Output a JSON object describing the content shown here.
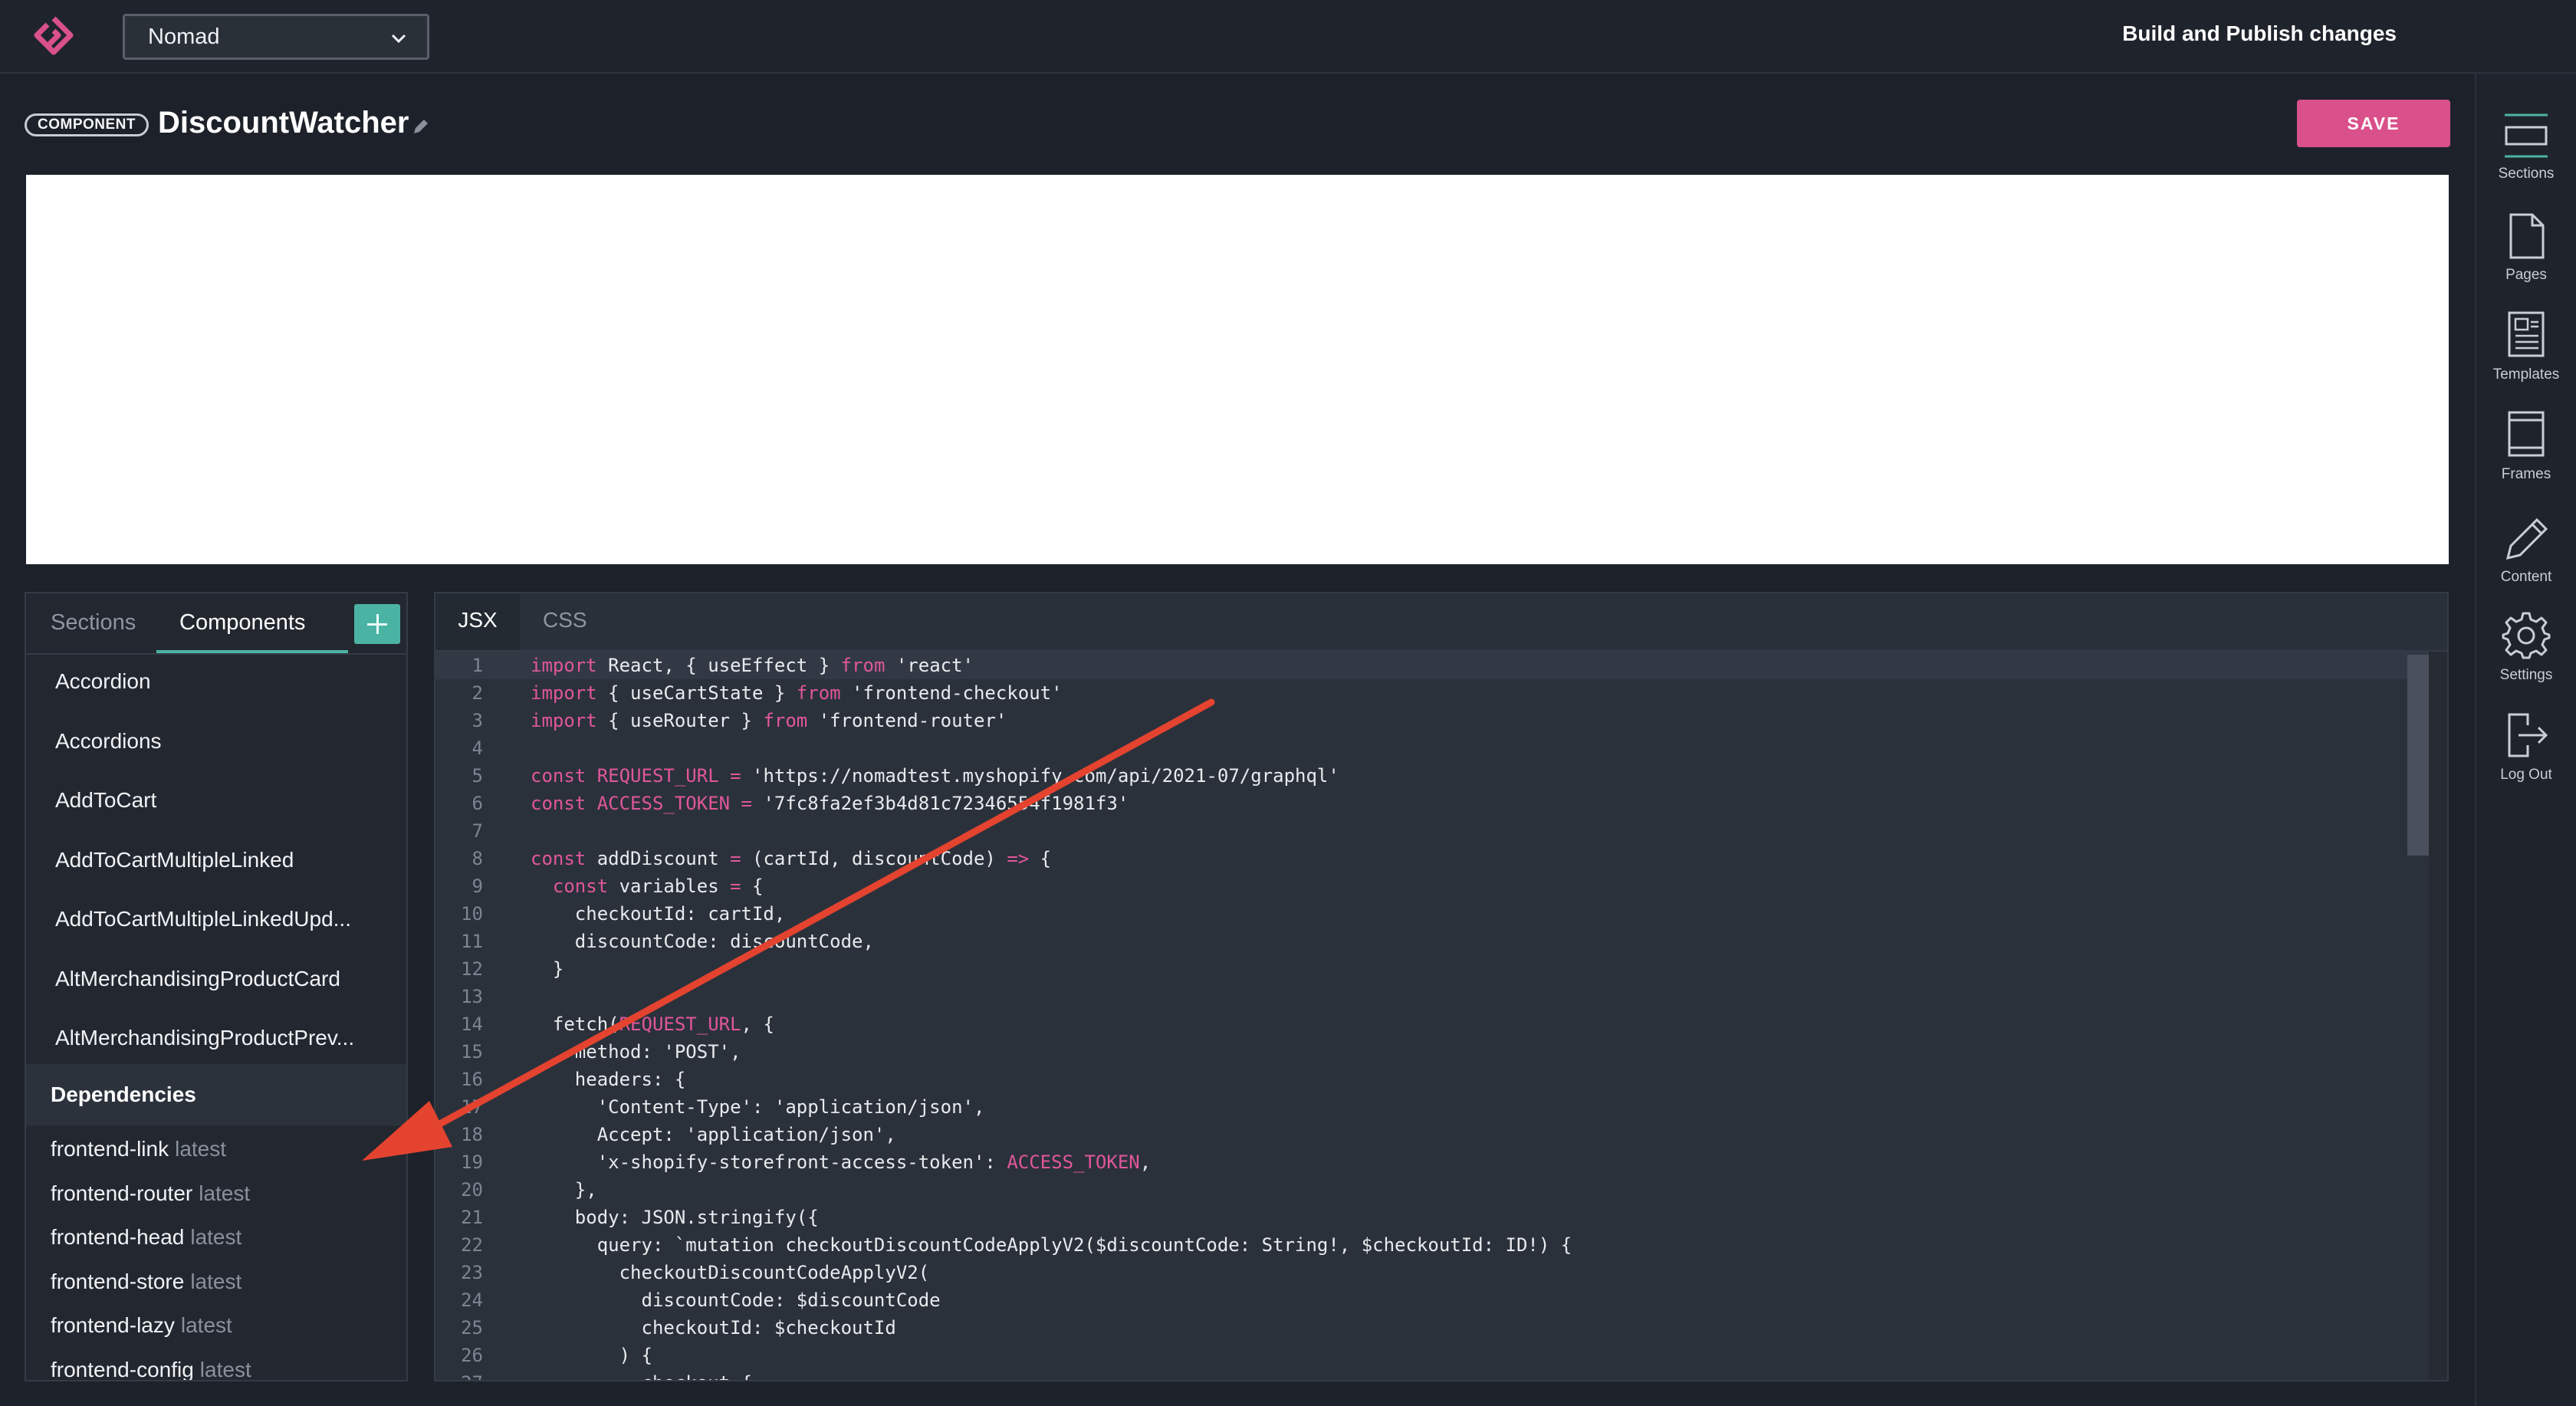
{
  "topbar": {
    "project": "Nomad",
    "publish_label": "Build and Publish changes"
  },
  "header": {
    "badge": "COMPONENT",
    "title": "DiscountWatcher",
    "save_label": "SAVE"
  },
  "left_panel": {
    "tabs": [
      "Sections",
      "Components"
    ],
    "active_tab": "Components",
    "components": [
      "Accordion",
      "Accordions",
      "AddToCart",
      "AddToCartMultipleLinked",
      "AddToCartMultipleLinkedUpd...",
      "AltMerchandisingProductCard",
      "AltMerchandisingProductPrev..."
    ],
    "dependencies_title": "Dependencies",
    "dependencies": [
      {
        "name": "frontend-link",
        "version": "latest"
      },
      {
        "name": "frontend-router",
        "version": "latest"
      },
      {
        "name": "frontend-head",
        "version": "latest"
      },
      {
        "name": "frontend-store",
        "version": "latest"
      },
      {
        "name": "frontend-lazy",
        "version": "latest"
      },
      {
        "name": "frontend-config",
        "version": "latest"
      }
    ]
  },
  "editor": {
    "tabs": [
      "JSX",
      "CSS"
    ],
    "active_tab": "JSX",
    "lines": [
      "import React, { useEffect } from 'react'",
      "import { useCartState } from 'frontend-checkout'",
      "import { useRouter } from 'frontend-router'",
      "",
      "const REQUEST_URL = 'https://nomadtest.myshopify.com/api/2021-07/graphql'",
      "const ACCESS_TOKEN = '7fc8fa2ef3b4d81c72346554f1981f3'",
      "",
      "const addDiscount = (cartId, discountCode) => {",
      "  const variables = {",
      "    checkoutId: cartId,",
      "    discountCode: discountCode,",
      "  }",
      "",
      "  fetch(REQUEST_URL, {",
      "    method: 'POST',",
      "    headers: {",
      "      'Content-Type': 'application/json',",
      "      Accept: 'application/json',",
      "      'x-shopify-storefront-access-token': ACCESS_TOKEN,",
      "    },",
      "    body: JSON.stringify({",
      "      query: `mutation checkoutDiscountCodeApplyV2($discountCode: String!, $checkoutId: ID!) {",
      "        checkoutDiscountCodeApplyV2(",
      "          discountCode: $discountCode",
      "          checkoutId: $checkoutId",
      "        ) {",
      "          checkout {"
    ]
  },
  "sidebar": {
    "items": [
      {
        "label": "Sections",
        "icon": "sections-icon"
      },
      {
        "label": "Pages",
        "icon": "page-icon"
      },
      {
        "label": "Templates",
        "icon": "templates-icon"
      },
      {
        "label": "Frames",
        "icon": "frames-icon"
      },
      {
        "label": "Content",
        "icon": "pencil-icon"
      },
      {
        "label": "Settings",
        "icon": "gear-icon"
      },
      {
        "label": "Log Out",
        "icon": "logout-icon"
      }
    ]
  },
  "colors": {
    "accent": "#4bb3a4",
    "save": "#d9508a",
    "keyword": "#e0579a",
    "annotation_arrow": "#e4432f"
  }
}
